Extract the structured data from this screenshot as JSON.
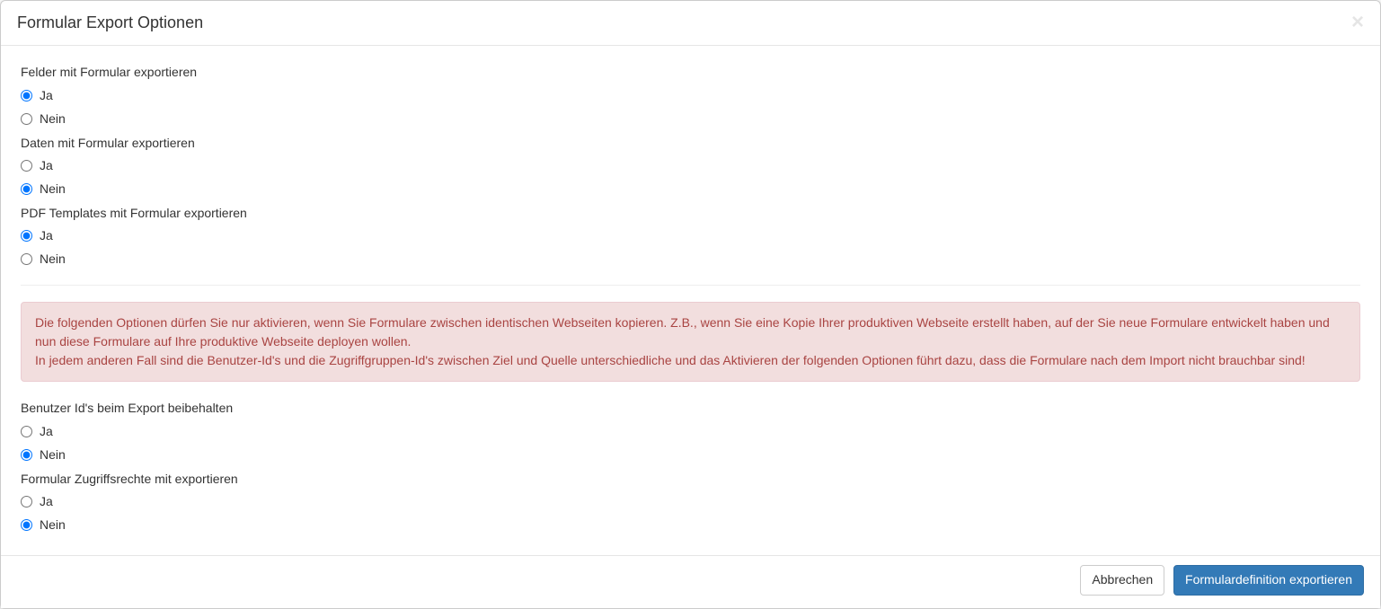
{
  "modal": {
    "title": "Formular Export Optionen",
    "close_label": "×"
  },
  "options": {
    "yes": "Ja",
    "no": "Nein"
  },
  "fields": {
    "export_fields": {
      "label": "Felder mit Formular exportieren"
    },
    "export_data": {
      "label": "Daten mit Formular exportieren"
    },
    "export_pdf": {
      "label": "PDF Templates mit Formular exportieren"
    },
    "keep_user_ids": {
      "label": "Benutzer Id's beim Export beibehalten"
    },
    "export_access": {
      "label": "Formular Zugriffsrechte mit exportieren"
    }
  },
  "warning": {
    "line1": "Die folgenden Optionen dürfen Sie nur aktivieren, wenn Sie Formulare zwischen identischen Webseiten kopieren. Z.B., wenn Sie eine Kopie Ihrer produktiven Webseite erstellt haben, auf der Sie neue Formulare entwickelt haben und nun diese Formulare auf Ihre produktive Webseite deployen wollen.",
    "line2": "In jedem anderen Fall sind die Benutzer-Id's und die Zugriffgruppen-Id's zwischen Ziel und Quelle unterschiedliche und das Aktivieren der folgenden Optionen führt dazu, dass die Formulare nach dem Import nicht brauchbar sind!"
  },
  "footer": {
    "cancel": "Abbrechen",
    "export": "Formulardefinition exportieren"
  }
}
